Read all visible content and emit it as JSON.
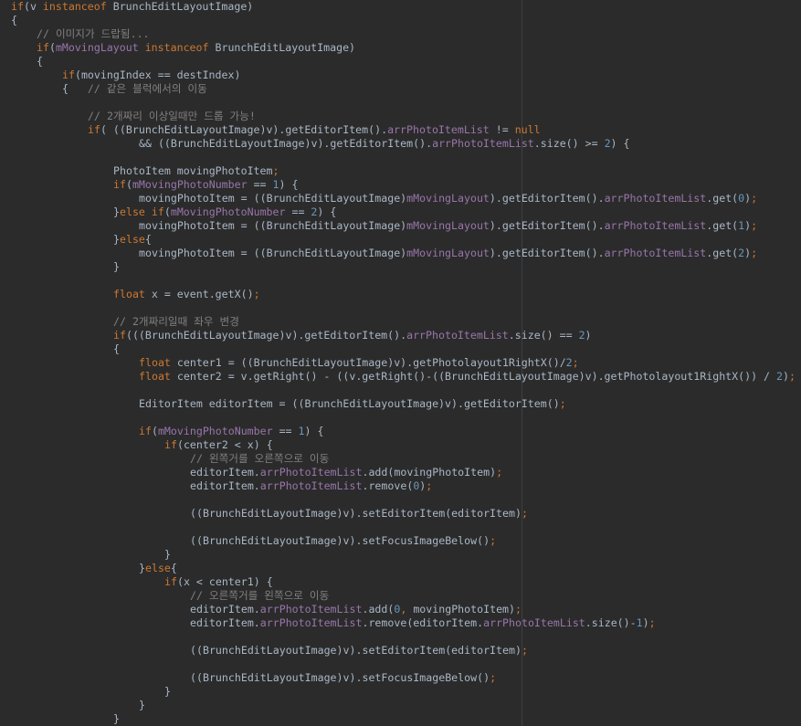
{
  "editor": {
    "language": "java",
    "colors": {
      "background": "#2b2b2b",
      "plain": "#a9b7c6",
      "keyword": "#cc7832",
      "field": "#9876aa",
      "number": "#6897bb",
      "comment": "#808080",
      "margin_guide": "#3c3f41"
    },
    "lines": [
      {
        "indent": 0,
        "tokens": [
          [
            "kw",
            "if"
          ],
          [
            "plain",
            "(v "
          ],
          [
            "kw",
            "instanceof"
          ],
          [
            "plain",
            " BrunchEditLayoutImage)"
          ]
        ]
      },
      {
        "indent": 0,
        "tokens": [
          [
            "plain",
            "{"
          ]
        ]
      },
      {
        "indent": 4,
        "tokens": [
          [
            "cmt",
            "// 이미지가 드랍됨..."
          ]
        ]
      },
      {
        "indent": 4,
        "tokens": [
          [
            "kw",
            "if"
          ],
          [
            "plain",
            "("
          ],
          [
            "fld",
            "mMovingLayout"
          ],
          [
            "plain",
            " "
          ],
          [
            "kw",
            "instanceof"
          ],
          [
            "plain",
            " BrunchEditLayoutImage)"
          ]
        ]
      },
      {
        "indent": 4,
        "tokens": [
          [
            "plain",
            "{"
          ]
        ]
      },
      {
        "indent": 8,
        "tokens": [
          [
            "kw",
            "if"
          ],
          [
            "plain",
            "(movingIndex == destIndex)"
          ]
        ]
      },
      {
        "indent": 8,
        "tokens": [
          [
            "plain",
            "{   "
          ],
          [
            "cmt",
            "// 같은 블럭에서의 이동"
          ]
        ]
      },
      {
        "indent": 0,
        "tokens": []
      },
      {
        "indent": 12,
        "tokens": [
          [
            "cmt",
            "// 2개짜리 이상일때만 드롭 가능!"
          ]
        ]
      },
      {
        "indent": 12,
        "tokens": [
          [
            "kw",
            "if"
          ],
          [
            "plain",
            "( ((BrunchEditLayoutImage)v).getEditorItem()."
          ],
          [
            "fld",
            "arrPhotoItemList"
          ],
          [
            "plain",
            " != "
          ],
          [
            "kw",
            "null"
          ]
        ]
      },
      {
        "indent": 20,
        "tokens": [
          [
            "plain",
            "&& ((BrunchEditLayoutImage)v).getEditorItem()."
          ],
          [
            "fld",
            "arrPhotoItemList"
          ],
          [
            "plain",
            ".size() >= "
          ],
          [
            "num",
            "2"
          ],
          [
            "plain",
            ") {"
          ]
        ]
      },
      {
        "indent": 0,
        "tokens": []
      },
      {
        "indent": 16,
        "tokens": [
          [
            "plain",
            "PhotoItem movingPhotoItem"
          ],
          [
            "kw",
            ";"
          ]
        ]
      },
      {
        "indent": 16,
        "tokens": [
          [
            "kw",
            "if"
          ],
          [
            "plain",
            "("
          ],
          [
            "fld",
            "mMovingPhotoNumber"
          ],
          [
            "plain",
            " == "
          ],
          [
            "num",
            "1"
          ],
          [
            "plain",
            ") {"
          ]
        ]
      },
      {
        "indent": 20,
        "tokens": [
          [
            "plain",
            "movingPhotoItem = ((BrunchEditLayoutImage)"
          ],
          [
            "fld",
            "mMovingLayout"
          ],
          [
            "plain",
            ").getEditorItem()."
          ],
          [
            "fld",
            "arrPhotoItemList"
          ],
          [
            "plain",
            ".get("
          ],
          [
            "num",
            "0"
          ],
          [
            "plain",
            ")"
          ],
          [
            "kw",
            ";"
          ]
        ]
      },
      {
        "indent": 16,
        "tokens": [
          [
            "plain",
            "}"
          ],
          [
            "kw",
            "else if"
          ],
          [
            "plain",
            "("
          ],
          [
            "fld",
            "mMovingPhotoNumber"
          ],
          [
            "plain",
            " == "
          ],
          [
            "num",
            "2"
          ],
          [
            "plain",
            ") {"
          ]
        ]
      },
      {
        "indent": 20,
        "tokens": [
          [
            "plain",
            "movingPhotoItem = ((BrunchEditLayoutImage)"
          ],
          [
            "fld",
            "mMovingLayout"
          ],
          [
            "plain",
            ").getEditorItem()."
          ],
          [
            "fld",
            "arrPhotoItemList"
          ],
          [
            "plain",
            ".get("
          ],
          [
            "num",
            "1"
          ],
          [
            "plain",
            ")"
          ],
          [
            "kw",
            ";"
          ]
        ]
      },
      {
        "indent": 16,
        "tokens": [
          [
            "plain",
            "}"
          ],
          [
            "kw",
            "else"
          ],
          [
            "plain",
            "{"
          ]
        ]
      },
      {
        "indent": 20,
        "tokens": [
          [
            "plain",
            "movingPhotoItem = ((BrunchEditLayoutImage)"
          ],
          [
            "fld",
            "mMovingLayout"
          ],
          [
            "plain",
            ").getEditorItem()."
          ],
          [
            "fld",
            "arrPhotoItemList"
          ],
          [
            "plain",
            ".get("
          ],
          [
            "num",
            "2"
          ],
          [
            "plain",
            ")"
          ],
          [
            "kw",
            ";"
          ]
        ]
      },
      {
        "indent": 16,
        "tokens": [
          [
            "plain",
            "}"
          ]
        ]
      },
      {
        "indent": 0,
        "tokens": []
      },
      {
        "indent": 16,
        "tokens": [
          [
            "kw",
            "float"
          ],
          [
            "plain",
            " x = event.getX()"
          ],
          [
            "kw",
            ";"
          ]
        ]
      },
      {
        "indent": 0,
        "tokens": []
      },
      {
        "indent": 16,
        "tokens": [
          [
            "cmt",
            "// 2개짜리일때 좌우 변경"
          ]
        ]
      },
      {
        "indent": 16,
        "tokens": [
          [
            "kw",
            "if"
          ],
          [
            "plain",
            "(((BrunchEditLayoutImage)v).getEditorItem()."
          ],
          [
            "fld",
            "arrPhotoItemList"
          ],
          [
            "plain",
            ".size() == "
          ],
          [
            "num",
            "2"
          ],
          [
            "plain",
            ")"
          ]
        ]
      },
      {
        "indent": 16,
        "tokens": [
          [
            "plain",
            "{"
          ]
        ]
      },
      {
        "indent": 20,
        "tokens": [
          [
            "kw",
            "float"
          ],
          [
            "plain",
            " center1 = ((BrunchEditLayoutImage)v).getPhotolayout1RightX()/"
          ],
          [
            "num",
            "2"
          ],
          [
            "kw",
            ";"
          ]
        ]
      },
      {
        "indent": 20,
        "tokens": [
          [
            "kw",
            "float"
          ],
          [
            "plain",
            " center2 = v.getRight() - ((v.getRight()-((BrunchEditLayoutImage)v).getPhotolayout1RightX()) / "
          ],
          [
            "num",
            "2"
          ],
          [
            "plain",
            ")"
          ],
          [
            "kw",
            ";"
          ]
        ]
      },
      {
        "indent": 0,
        "tokens": []
      },
      {
        "indent": 20,
        "tokens": [
          [
            "plain",
            "EditorItem editorItem = ((BrunchEditLayoutImage)v).getEditorItem()"
          ],
          [
            "kw",
            ";"
          ]
        ]
      },
      {
        "indent": 0,
        "tokens": []
      },
      {
        "indent": 20,
        "tokens": [
          [
            "kw",
            "if"
          ],
          [
            "plain",
            "("
          ],
          [
            "fld",
            "mMovingPhotoNumber"
          ],
          [
            "plain",
            " == "
          ],
          [
            "num",
            "1"
          ],
          [
            "plain",
            ") {"
          ]
        ]
      },
      {
        "indent": 24,
        "tokens": [
          [
            "kw",
            "if"
          ],
          [
            "plain",
            "(center2 < x) {"
          ]
        ]
      },
      {
        "indent": 28,
        "tokens": [
          [
            "cmt",
            "// 왼쪽거를 오른쪽으로 이동"
          ]
        ]
      },
      {
        "indent": 28,
        "tokens": [
          [
            "plain",
            "editorItem."
          ],
          [
            "fld",
            "arrPhotoItemList"
          ],
          [
            "plain",
            ".add(movingPhotoItem)"
          ],
          [
            "kw",
            ";"
          ]
        ]
      },
      {
        "indent": 28,
        "tokens": [
          [
            "plain",
            "editorItem."
          ],
          [
            "fld",
            "arrPhotoItemList"
          ],
          [
            "plain",
            ".remove("
          ],
          [
            "num",
            "0"
          ],
          [
            "plain",
            ")"
          ],
          [
            "kw",
            ";"
          ]
        ]
      },
      {
        "indent": 0,
        "tokens": []
      },
      {
        "indent": 28,
        "tokens": [
          [
            "plain",
            "((BrunchEditLayoutImage)v).setEditorItem(editorItem)"
          ],
          [
            "kw",
            ";"
          ]
        ]
      },
      {
        "indent": 0,
        "tokens": []
      },
      {
        "indent": 28,
        "tokens": [
          [
            "plain",
            "((BrunchEditLayoutImage)v).setFocusImageBelow()"
          ],
          [
            "kw",
            ";"
          ]
        ]
      },
      {
        "indent": 24,
        "tokens": [
          [
            "plain",
            "}"
          ]
        ]
      },
      {
        "indent": 20,
        "tokens": [
          [
            "plain",
            "}"
          ],
          [
            "kw",
            "else"
          ],
          [
            "plain",
            "{"
          ]
        ]
      },
      {
        "indent": 24,
        "tokens": [
          [
            "kw",
            "if"
          ],
          [
            "plain",
            "(x < center1) {"
          ]
        ]
      },
      {
        "indent": 28,
        "tokens": [
          [
            "cmt",
            "// 오른쪽거를 왼쪽으로 이동"
          ]
        ]
      },
      {
        "indent": 28,
        "tokens": [
          [
            "plain",
            "editorItem."
          ],
          [
            "fld",
            "arrPhotoItemList"
          ],
          [
            "plain",
            ".add("
          ],
          [
            "num",
            "0"
          ],
          [
            "kw",
            ","
          ],
          [
            "plain",
            " movingPhotoItem)"
          ],
          [
            "kw",
            ";"
          ]
        ]
      },
      {
        "indent": 28,
        "tokens": [
          [
            "plain",
            "editorItem."
          ],
          [
            "fld",
            "arrPhotoItemList"
          ],
          [
            "plain",
            ".remove(editorItem."
          ],
          [
            "fld",
            "arrPhotoItemList"
          ],
          [
            "plain",
            ".size()-"
          ],
          [
            "num",
            "1"
          ],
          [
            "plain",
            ")"
          ],
          [
            "kw",
            ";"
          ]
        ]
      },
      {
        "indent": 0,
        "tokens": []
      },
      {
        "indent": 28,
        "tokens": [
          [
            "plain",
            "((BrunchEditLayoutImage)v).setEditorItem(editorItem)"
          ],
          [
            "kw",
            ";"
          ]
        ]
      },
      {
        "indent": 0,
        "tokens": []
      },
      {
        "indent": 28,
        "tokens": [
          [
            "plain",
            "((BrunchEditLayoutImage)v).setFocusImageBelow()"
          ],
          [
            "kw",
            ";"
          ]
        ]
      },
      {
        "indent": 24,
        "tokens": [
          [
            "plain",
            "}"
          ]
        ]
      },
      {
        "indent": 20,
        "tokens": [
          [
            "plain",
            "}"
          ]
        ]
      },
      {
        "indent": 16,
        "tokens": [
          [
            "plain",
            "}"
          ]
        ]
      }
    ]
  }
}
